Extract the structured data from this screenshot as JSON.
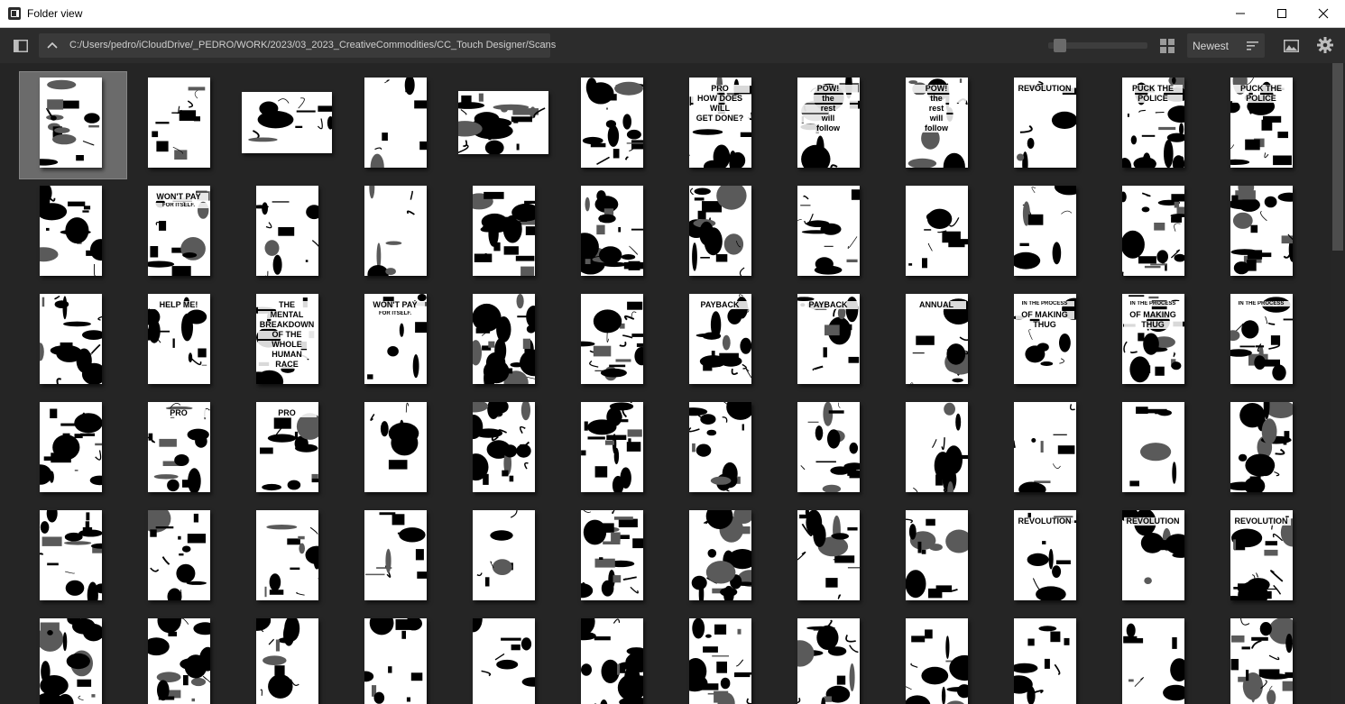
{
  "window": {
    "title": "Folder view"
  },
  "toolbar": {
    "path": "C:/Users/pedro/iCloudDrive/_PEDRO/WORK/2023/03_2023_CreativeCommodities/CC_Touch Designer/Scans",
    "sort_label": "Newest",
    "zoom_level": 0.1
  },
  "grid": {
    "selected_index": 0,
    "columns": 12,
    "thumbs": [
      "portrait",
      "portrait",
      "landscape",
      "portrait",
      "landscape",
      "portrait",
      "portrait",
      "portrait",
      "portrait",
      "portrait",
      "portrait",
      "portrait",
      "portrait",
      "portrait",
      "portrait",
      "portrait",
      "portrait",
      "portrait",
      "portrait",
      "portrait",
      "portrait",
      "portrait",
      "portrait",
      "portrait",
      "portrait",
      "portrait",
      "portrait",
      "portrait",
      "portrait",
      "portrait",
      "portrait",
      "portrait",
      "portrait",
      "portrait",
      "portrait",
      "portrait",
      "portrait",
      "portrait",
      "portrait",
      "portrait",
      "portrait",
      "portrait",
      "portrait",
      "portrait",
      "portrait",
      "portrait",
      "portrait",
      "portrait",
      "portrait",
      "portrait",
      "portrait",
      "portrait",
      "portrait",
      "portrait",
      "portrait",
      "portrait",
      "portrait",
      "portrait",
      "portrait",
      "portrait",
      "portrait",
      "portrait",
      "portrait",
      "portrait",
      "portrait",
      "portrait",
      "portrait",
      "portrait",
      "portrait",
      "portrait",
      "portrait",
      "portrait"
    ],
    "captions": {
      "6": [
        "PRO",
        "HOW DOES",
        "WILL",
        "GET DONE?"
      ],
      "7": [
        "POW!",
        "the",
        "rest",
        "will",
        "follow"
      ],
      "8": [
        "POW!",
        "the",
        "rest",
        "will",
        "follow"
      ],
      "9": [
        "REVOLUTION"
      ],
      "10": [
        "PUCK THE",
        "POLICE"
      ],
      "11": [
        "PUCK THE",
        "POLICE"
      ],
      "13": [
        "WON'T PAY",
        "FOR ITSELF."
      ],
      "25": [
        "HELP ME!"
      ],
      "26": [
        "THE",
        "MENTAL",
        "BREAKDOWN",
        "OF THE",
        "WHOLE",
        "HUMAN",
        "RACE"
      ],
      "27": [
        "WON'T PAY",
        "FOR ITSELF."
      ],
      "30": [
        "PAYBACK"
      ],
      "31": [
        "PAYBACK"
      ],
      "32": [
        "ANNUAL"
      ],
      "33": [
        "IN THE PROCESS",
        "OF MAKING",
        "THUG"
      ],
      "34": [
        "IN THE PROCESS",
        "OF MAKING",
        "THUG"
      ],
      "35": [
        "IN THE PROCESS"
      ],
      "37": [
        "PRO"
      ],
      "38": [
        "PRO"
      ],
      "57": [
        "REVOLUTION"
      ],
      "58": [
        "REVOLUTION"
      ],
      "59": [
        "REVOLUTION"
      ]
    }
  },
  "icons": {
    "sidebar_toggle": "sidebar-toggle-icon",
    "up": "chevron-up-icon",
    "grid_view": "grid-view-icon",
    "sort": "sort-icon",
    "image": "image-icon",
    "settings": "gear-icon"
  }
}
